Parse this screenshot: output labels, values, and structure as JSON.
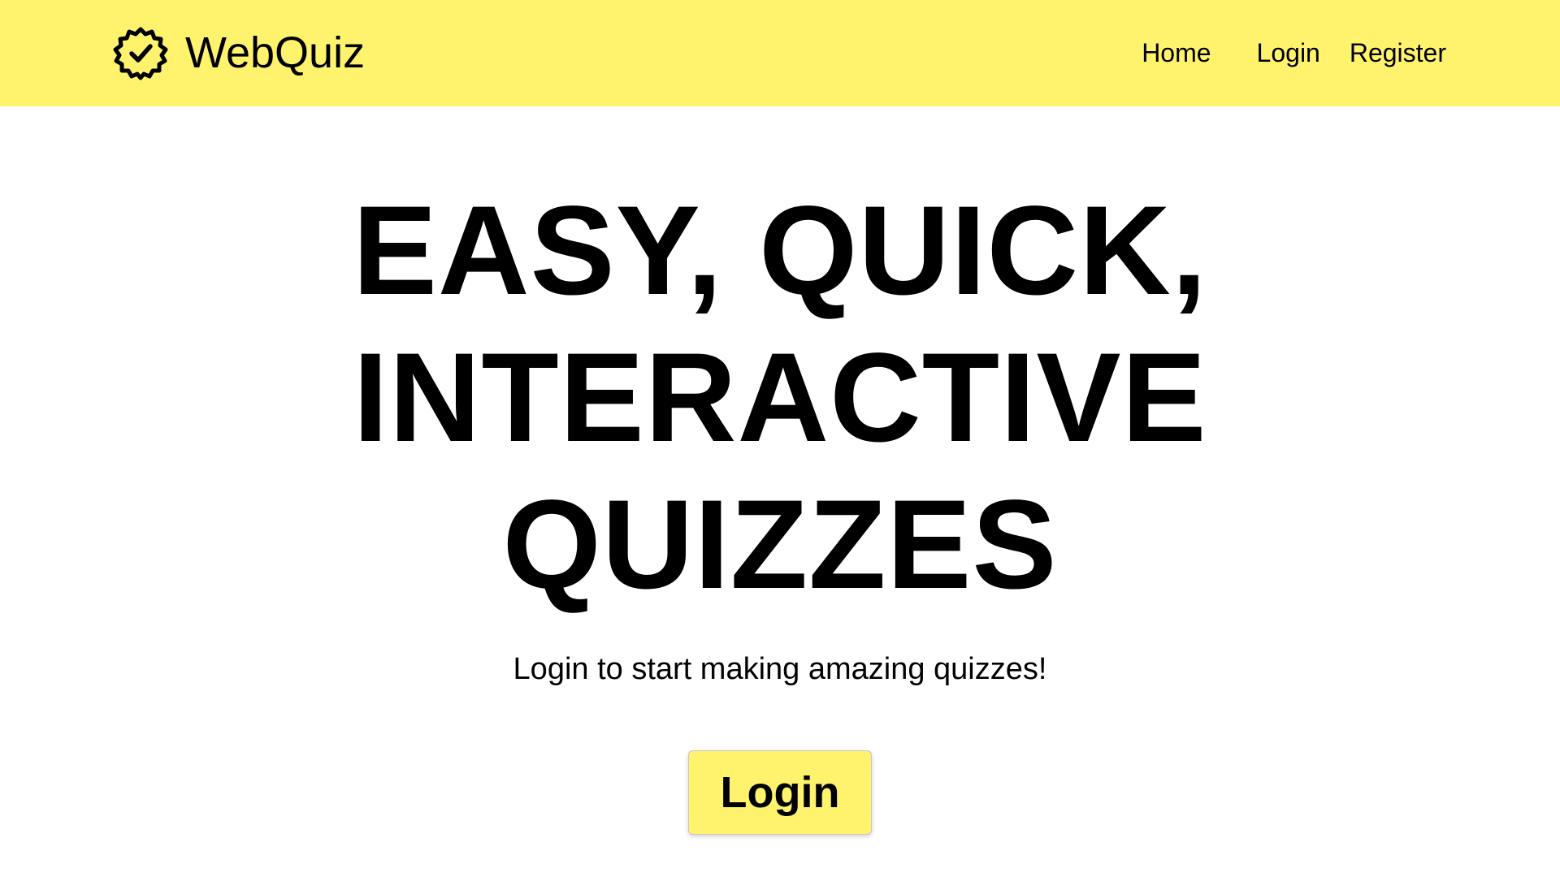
{
  "theme": {
    "accent": "#FFF36E",
    "text": "#000000",
    "background": "#FFFFFF"
  },
  "header": {
    "brand_name": "WebQuiz",
    "brand_icon": "badge-check-icon",
    "nav": {
      "home": "Home",
      "login": "Login",
      "register": "Register"
    }
  },
  "hero": {
    "headline_lines": [
      "EASY, QUICK,",
      "INTERACTIVE",
      "QUIZZES"
    ],
    "subtitle": "Login to start making amazing quizzes!",
    "cta_label": "Login"
  }
}
